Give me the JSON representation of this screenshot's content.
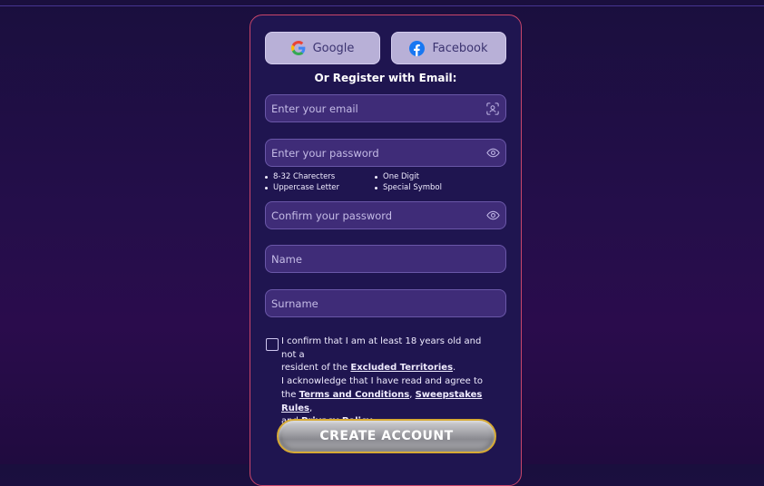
{
  "social": {
    "google": {
      "label": "Google",
      "icon": "google-icon"
    },
    "facebook": {
      "label": "Facebook",
      "icon": "facebook-icon"
    }
  },
  "register": {
    "or_text": "Or Register with Email:",
    "email_placeholder": "Enter your email",
    "password_placeholder": "Enter your password",
    "confirm_placeholder": "Confirm your password",
    "name_placeholder": "Name",
    "surname_placeholder": "Surname"
  },
  "password_rules": {
    "left": [
      "8-32 Charecters",
      "Uppercase Letter"
    ],
    "right": [
      "One Digit",
      "Special Symbol"
    ]
  },
  "terms": {
    "line1a": "I confirm that I am at least 18 years old and not a",
    "line2a": "resident of the ",
    "excluded_link": "Excluded Territories",
    "line2b": ".",
    "line3": "I acknowledge that I have read and agree to",
    "line4a": "the ",
    "terms_link": "Terms and Conditions",
    "comma1": ", ",
    "sweepstakes_link": "Sweepstakes Rules",
    "comma2": ",",
    "line5a": "and ",
    "privacy_link": "Privacy Policy",
    "line5b": "."
  },
  "cta": {
    "label": "CREATE ACCOUNT"
  },
  "colors": {
    "card_border": "#c9466a",
    "cta_border": "#d6a934",
    "field_bg": "#3f2c78"
  }
}
